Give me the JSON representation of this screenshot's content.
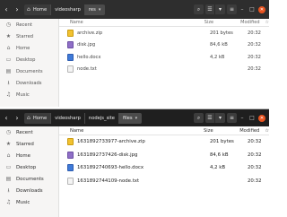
{
  "colors": {
    "accent": "#e95420",
    "headerbar_top": "#2e2e2e",
    "headerbar_bottom": "#1f1f1f",
    "sidebar_bg": "#f6f5f4"
  },
  "window_top": {
    "nav": {
      "back_icon": "chevron-left-icon",
      "forward_icon": "chevron-right-icon"
    },
    "breadcrumbs": [
      "Home",
      "videosharp",
      "res"
    ],
    "active_crumb_suffix": "▾",
    "toolbar": {
      "search_icon": "search-icon",
      "view_icon": "list-view-icon",
      "view_options": "▾",
      "menu_icon": "hamburger-menu-icon"
    },
    "controls": {
      "minimize": "–",
      "maximize": "□",
      "close": "✕"
    },
    "sidebar": [
      {
        "icon": "clock-icon",
        "glyph": "◷",
        "label": "Recent"
      },
      {
        "icon": "star-icon",
        "glyph": "★",
        "label": "Starred"
      },
      {
        "icon": "home-icon",
        "glyph": "⌂",
        "label": "Home"
      },
      {
        "icon": "desktop-icon",
        "glyph": "▭",
        "label": "Desktop"
      },
      {
        "icon": "documents-icon",
        "glyph": "▤",
        "label": "Documents"
      },
      {
        "icon": "downloads-icon",
        "glyph": "⭳",
        "label": "Downloads"
      },
      {
        "icon": "music-icon",
        "glyph": "♫",
        "label": "Music"
      }
    ],
    "columns": {
      "name": "Name",
      "size": "Size",
      "modified": "Modified",
      "star": "☆"
    },
    "files": [
      {
        "name": "archive.zip",
        "size": "201 bytes",
        "modified": "20:32",
        "type": "zip"
      },
      {
        "name": "disk.jpg",
        "size": "84,6 kB",
        "modified": "20:32",
        "type": "jpg"
      },
      {
        "name": "hello.docx",
        "size": "4,2 kB",
        "modified": "20:32",
        "type": "docx"
      },
      {
        "name": "node.txt",
        "size": "",
        "modified": "20:32",
        "type": "txt"
      }
    ]
  },
  "window_bottom": {
    "nav": {
      "back_icon": "chevron-left-icon",
      "forward_icon": "chevron-right-icon"
    },
    "breadcrumbs": [
      "Home",
      "videosharp",
      "nodejs_site",
      "files"
    ],
    "active_crumb_suffix": "▾",
    "toolbar": {
      "search_icon": "search-icon",
      "view_icon": "list-view-icon",
      "view_options": "▾",
      "menu_icon": "hamburger-menu-icon"
    },
    "controls": {
      "minimize": "–",
      "maximize": "□",
      "close": "✕"
    },
    "sidebar": [
      {
        "icon": "clock-icon",
        "glyph": "◷",
        "label": "Recent"
      },
      {
        "icon": "star-icon",
        "glyph": "★",
        "label": "Starred"
      },
      {
        "icon": "home-icon",
        "glyph": "⌂",
        "label": "Home"
      },
      {
        "icon": "desktop-icon",
        "glyph": "▭",
        "label": "Desktop"
      },
      {
        "icon": "documents-icon",
        "glyph": "▤",
        "label": "Documents"
      },
      {
        "icon": "downloads-icon",
        "glyph": "⭳",
        "label": "Downloads"
      },
      {
        "icon": "music-icon",
        "glyph": "♫",
        "label": "Music"
      }
    ],
    "columns": {
      "name": "Name",
      "size": "Size",
      "modified": "Modified",
      "star": "☆"
    },
    "files": [
      {
        "name": "1631892733977-archive.zip",
        "size": "201 bytes",
        "modified": "20:32",
        "type": "zip"
      },
      {
        "name": "1631892737426-disk.jpg",
        "size": "84,6 kB",
        "modified": "20:32",
        "type": "jpg"
      },
      {
        "name": "1631892740693-hello.docx",
        "size": "4,2 kB",
        "modified": "20:32",
        "type": "docx"
      },
      {
        "name": "1631892744109-node.txt",
        "size": "",
        "modified": "20:32",
        "type": "txt"
      }
    ]
  }
}
